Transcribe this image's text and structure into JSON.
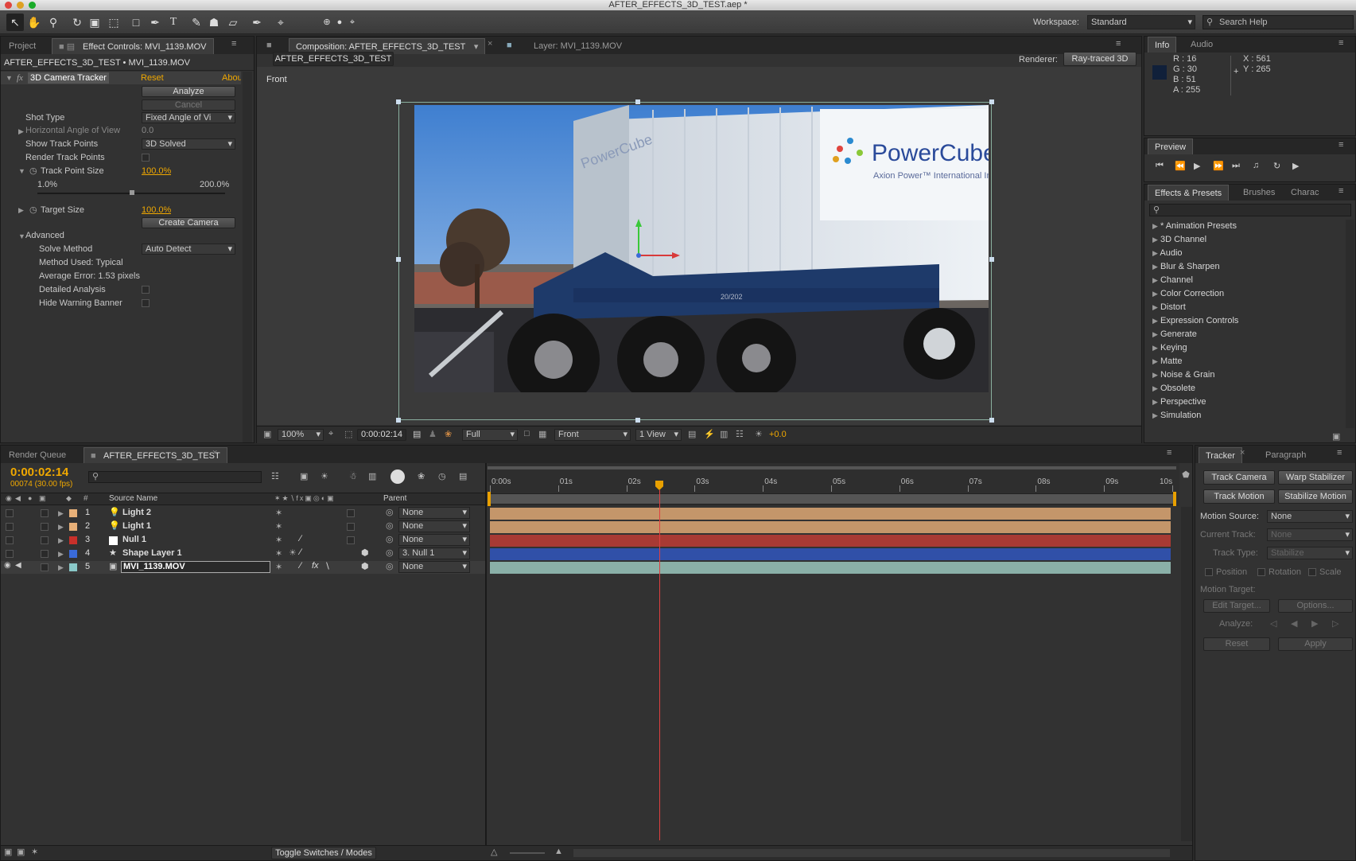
{
  "window": {
    "title": "AFTER_EFFECTS_3D_TEST.aep *"
  },
  "toolbar": {
    "tools": [
      "select-icon",
      "hand-icon",
      "zoom-icon",
      "rotate-icon",
      "camera-orbit-icon",
      "pan-behind-icon",
      "rectangle-icon",
      "pen-icon",
      "type-icon",
      "brush-icon",
      "clone-stamp-icon",
      "eraser-icon",
      "roto-brush-icon",
      "puppet-pin-icon"
    ],
    "workspace_label": "Workspace:",
    "workspace_value": "Standard",
    "search_placeholder": "Search Help"
  },
  "left_panel": {
    "tabs": [
      "Project",
      "Effect Controls: MVI_1139.MOV"
    ],
    "header": "AFTER_EFFECTS_3D_TEST • MVI_1139.MOV",
    "effect": {
      "fx": "fx",
      "name": "3D Camera Tracker",
      "reset": "Reset",
      "about": "Abou",
      "analyze": "Analyze",
      "cancel": "Cancel",
      "shot_type_label": "Shot Type",
      "shot_type_value": "Fixed Angle of Vi",
      "hav_label": "Horizontal Angle of View",
      "hav_value": "0.0",
      "show_track_points_label": "Show Track Points",
      "show_track_points_value": "3D Solved",
      "render_track_points_label": "Render Track Points",
      "track_point_size_label": "Track Point Size",
      "track_point_size_value": "100.0%",
      "range_min": "1.0%",
      "range_max": "200.0%",
      "target_size_label": "Target Size",
      "target_size_value": "100.0%",
      "create_camera": "Create Camera",
      "advanced_label": "Advanced",
      "solve_method_label": "Solve Method",
      "solve_method_value": "Auto Detect",
      "method_used": "Method Used: Typical",
      "average_error": "Average Error: 1.53 pixels",
      "detailed_analysis_label": "Detailed Analysis",
      "hide_warning_label": "Hide Warning Banner"
    }
  },
  "comp_panel": {
    "tabs": [
      "Composition: AFTER_EFFECTS_3D_TEST",
      "Layer: MVI_1139.MOV"
    ],
    "comp_button": "AFTER_EFFECTS_3D_TEST",
    "renderer_label": "Renderer:",
    "renderer_value": "Ray-traced 3D",
    "view_label": "Front",
    "footer": {
      "zoom": "100%",
      "timecode": "0:00:02:14",
      "resolution": "Full",
      "view": "Front",
      "views": "1 View",
      "exposure": "+0.0"
    },
    "image": {
      "brand": "PowerCube",
      "sub": "Axion Power™ International Inc.",
      "side_brand": "PowerCube",
      "plate": "20/202"
    }
  },
  "info_panel": {
    "tabs": [
      "Info",
      "Audio"
    ],
    "r": "R : 16",
    "g": "G : 30",
    "b": "B : 51",
    "a": "A : 255",
    "x": "X : 561",
    "y": "Y : 265",
    "swatch": "#10203a"
  },
  "preview_panel": {
    "tab": "Preview"
  },
  "effects_presets": {
    "tabs": [
      "Effects & Presets",
      "Brushes",
      "Charac"
    ],
    "items": [
      "* Animation Presets",
      "3D Channel",
      "Audio",
      "Blur & Sharpen",
      "Channel",
      "Color Correction",
      "Distort",
      "Expression Controls",
      "Generate",
      "Keying",
      "Matte",
      "Noise & Grain",
      "Obsolete",
      "Perspective",
      "Simulation"
    ]
  },
  "timeline": {
    "tabs": [
      "Render Queue",
      "AFTER_EFFECTS_3D_TEST"
    ],
    "timecode": "0:00:02:14",
    "frames": "00074 (30.00 fps)",
    "col_hash": "#",
    "col_source": "Source Name",
    "col_parent": "Parent",
    "layers": [
      {
        "num": "1",
        "name": "Light 2",
        "parent": "None",
        "label_color": "#e8b078",
        "bar_color": "#c4966a"
      },
      {
        "num": "2",
        "name": "Light 1",
        "parent": "None",
        "label_color": "#e8b078",
        "bar_color": "#c4966a"
      },
      {
        "num": "3",
        "name": "Null 1",
        "parent": "None",
        "label_color": "#c8302a",
        "bar_color": "#a83a34"
      },
      {
        "num": "4",
        "name": "Shape Layer 1",
        "parent": "3. Null 1",
        "label_color": "#3a6ad8",
        "bar_color": "#3050a8"
      },
      {
        "num": "5",
        "name": "MVI_1139.MOV",
        "parent": "None",
        "label_color": "#8ac8c8",
        "bar_color": "#8ab0a8"
      }
    ],
    "ruler": [
      "0:00s",
      "01s",
      "02s",
      "03s",
      "04s",
      "05s",
      "06s",
      "07s",
      "08s",
      "09s",
      "10s"
    ],
    "toggle_label": "Toggle Switches / Modes"
  },
  "tracker_panel": {
    "tabs": [
      "Tracker",
      "Paragraph"
    ],
    "track_camera": "Track Camera",
    "warp_stabilizer": "Warp Stabilizer",
    "track_motion": "Track Motion",
    "stabilize_motion": "Stabilize Motion",
    "motion_source_label": "Motion Source:",
    "motion_source_value": "None",
    "current_track_label": "Current Track:",
    "current_track_value": "None",
    "track_type_label": "Track Type:",
    "track_type_value": "Stabilize",
    "position": "Position",
    "rotation": "Rotation",
    "scale": "Scale",
    "motion_target_label": "Motion Target:",
    "edit_target": "Edit Target...",
    "options": "Options...",
    "analyze_label": "Analyze:",
    "reset": "Reset",
    "apply": "Apply"
  }
}
